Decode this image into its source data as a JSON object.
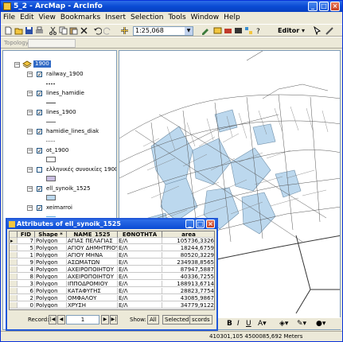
{
  "window": {
    "title": "5_2 - ArcMap - ArcInfo"
  },
  "menu": [
    "File",
    "Edit",
    "View",
    "Bookmarks",
    "Insert",
    "Selection",
    "Tools",
    "Window",
    "Help"
  ],
  "toolbar": {
    "scale": "1:25,068",
    "editor_label": "Editor ▾",
    "topology_label": "Topology:"
  },
  "toc": {
    "root": "1900",
    "layers": [
      {
        "name": "railway_1900",
        "checked": true
      },
      {
        "name": "lines_hamidie",
        "checked": true
      },
      {
        "name": "lines_1900",
        "checked": true
      },
      {
        "name": "hamidie_lines_diak",
        "checked": true
      },
      {
        "name": "ot_1900",
        "checked": true
      },
      {
        "name": "ελληνικές συνοικίες 1900",
        "checked": false
      },
      {
        "name": "ell_synoik_1525",
        "checked": true
      },
      {
        "name": "xeimarroi",
        "checked": true
      }
    ]
  },
  "attributes": {
    "title": "Attributes of ell_synoik_1525",
    "columns": [
      "FID",
      "Shape *",
      "NAME_1525",
      "ΕΘΝΟΤΗΤΑ",
      "area"
    ],
    "rows": [
      [
        "7",
        "Polygon",
        "ΑΓΙΑΣ ΠΕΛΑΓΙΑΣ",
        "Ε/Λ",
        "105736,3326"
      ],
      [
        "5",
        "Polygon",
        "ΑΓΙΟΥ ΔΗΜΗΤΡΙΟΥ",
        "Ε/Λ",
        "18244,6759"
      ],
      [
        "1",
        "Polygon",
        "ΑΓΙΟΥ ΜΗΝΑ",
        "Ε/Λ",
        "80520,3229"
      ],
      [
        "9",
        "Polygon",
        "ΑΣΩΜΑΤΩΝ",
        "Ε/Λ",
        "234938,8565"
      ],
      [
        "4",
        "Polygon",
        "ΑΧΕΙΡΟΠΟΙΗΤΟΥ",
        "Ε/Λ",
        "87947,5887"
      ],
      [
        "8",
        "Polygon",
        "ΑΧΕΙΡΟΠΟΙΗΤΟΥ",
        "Ε/Λ",
        "40336,7255"
      ],
      [
        "3",
        "Polygon",
        "ΙΠΠΟΔΡΟΜΙΟΥ",
        "Ε/Λ",
        "188913,6714"
      ],
      [
        "6",
        "Polygon",
        "ΚΑΤΑΦΥΓΗΣ",
        "Ε/Λ",
        "28823,7754"
      ],
      [
        "2",
        "Polygon",
        "ΟΜΦΑΛΟΥ",
        "Ε/Λ",
        "43085,9867"
      ],
      [
        "0",
        "Polygon",
        "ΧΡΥΣΗ",
        "Ε/Λ",
        "34779,9122"
      ]
    ],
    "record_label": "Record:",
    "record_value": "1",
    "show_label": "Show:",
    "all_label": "All",
    "selected_label": "Selected",
    "records_label": "scords"
  },
  "status": {
    "coords": "410301,105  4500085,692 Meters"
  },
  "colors": {
    "selection_fill": "#bcd8ee",
    "title_blue": "#0a4bd4"
  }
}
